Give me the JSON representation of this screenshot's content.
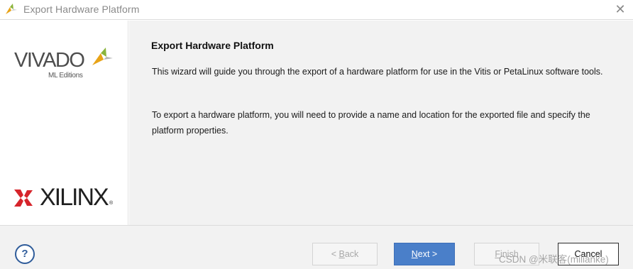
{
  "window": {
    "title": "Export Hardware Platform",
    "close_glyph": "✕",
    "icon": "vivado-leaf-icon"
  },
  "sidebar": {
    "vivado_logo": "VIVADO",
    "vivado_edition": "ML Editions",
    "xilinx_logo": "XILINX",
    "xilinx_trademark": "®"
  },
  "content": {
    "heading": "Export Hardware Platform",
    "paragraph1": "This wizard will guide you through the export of a hardware platform for use in the Vitis or PetaLinux software tools.",
    "paragraph2": "To export a hardware platform, you will need to provide a name and location for the exported file and specify the platform properties."
  },
  "footer": {
    "help_glyph": "?",
    "back": {
      "prefix": "< ",
      "mnemonic": "B",
      "rest": "ack",
      "enabled": false
    },
    "next": {
      "mnemonic": "N",
      "rest": "ext >",
      "enabled": true
    },
    "finish": {
      "mnemonic": "F",
      "rest": "inish",
      "enabled": false
    },
    "cancel": {
      "label": "Cancel",
      "enabled": true
    }
  },
  "watermark": "CSDN @米联客(milianke)",
  "colors": {
    "accent": "#4a7fc9",
    "content_bg": "#f2f2f2",
    "help_blue": "#2f5c9a",
    "vivado_leaf_green": "#8ab43c",
    "vivado_leaf_yellow": "#e8a317",
    "xilinx_red": "#d6242b"
  }
}
